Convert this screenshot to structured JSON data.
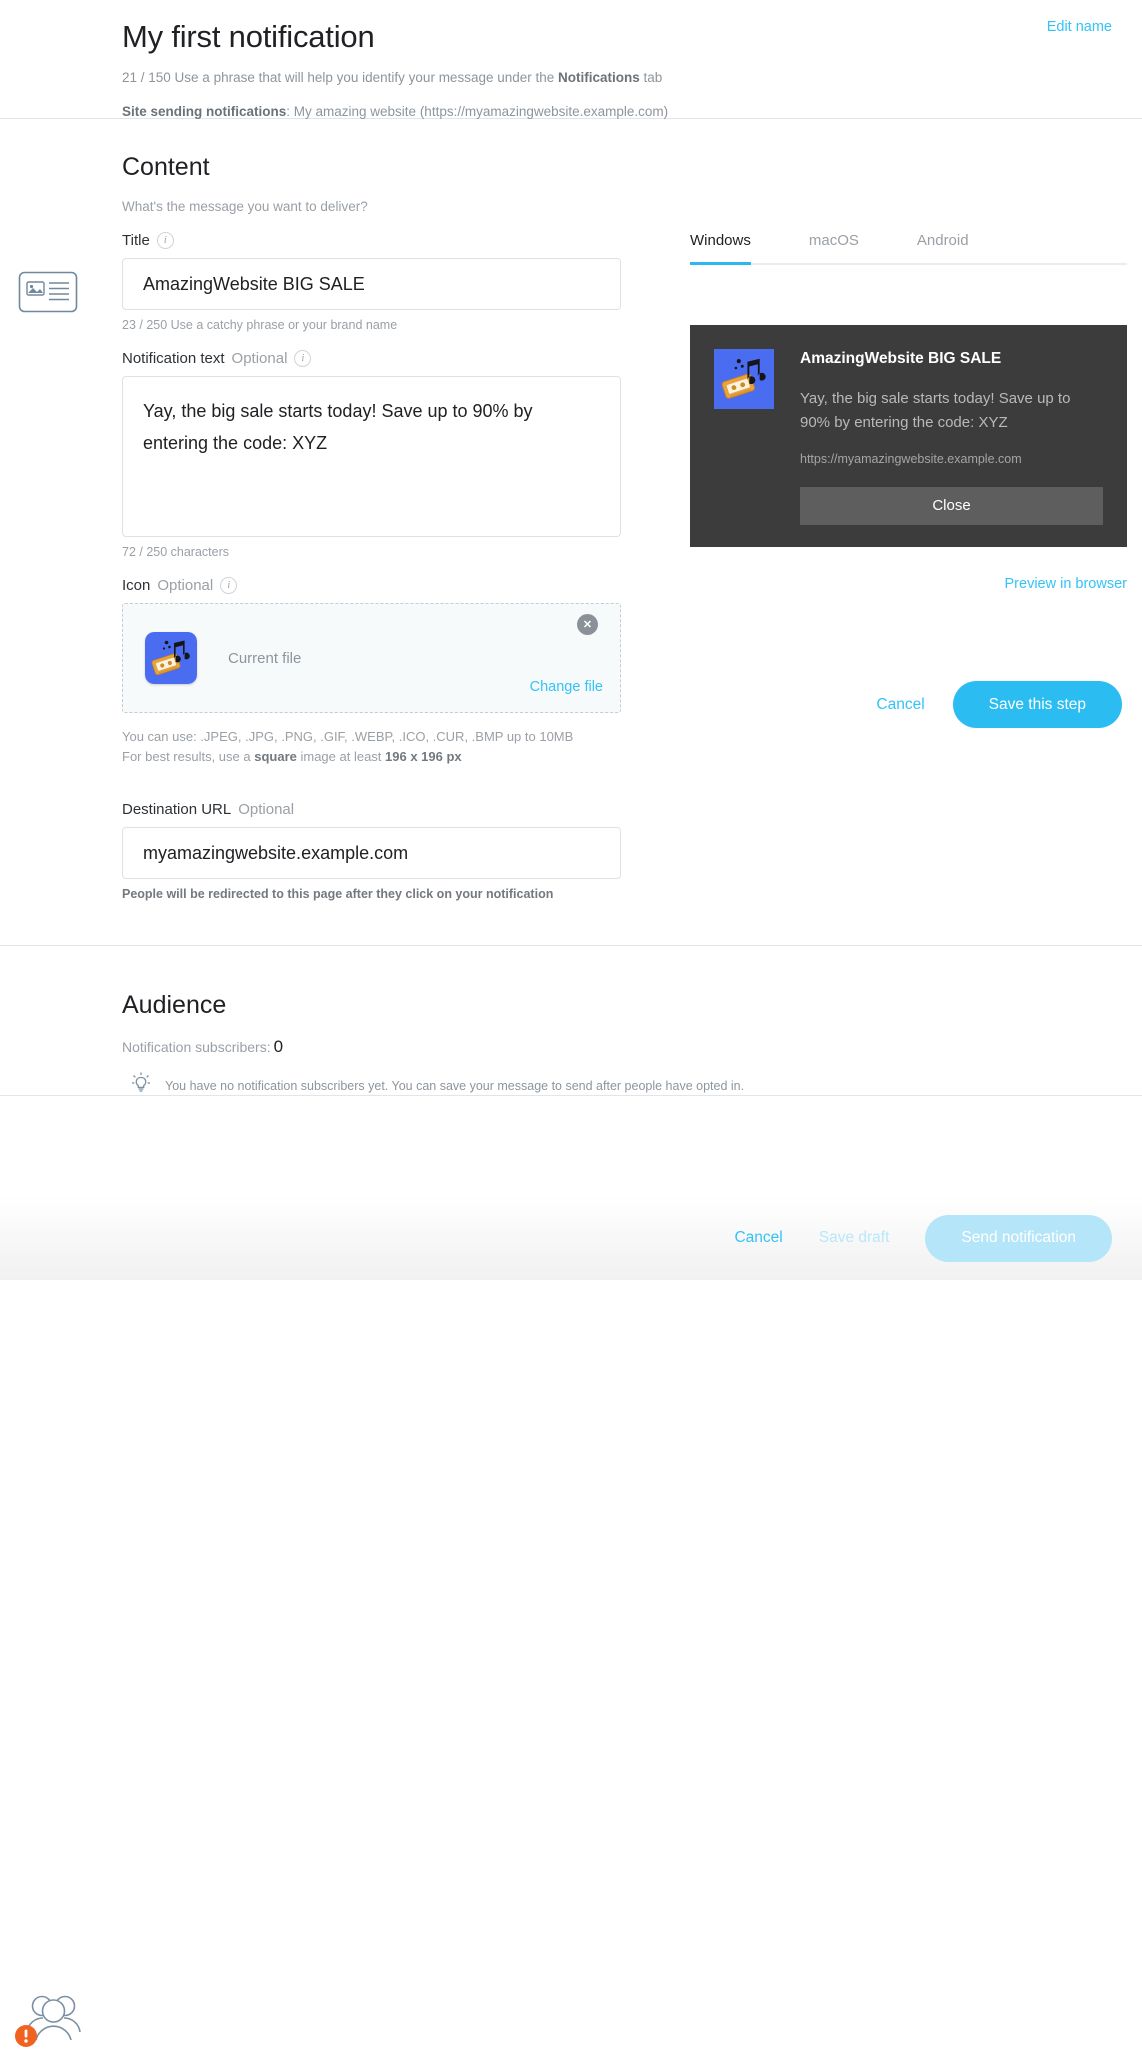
{
  "header": {
    "title": "My first notification",
    "edit_name_label": "Edit name",
    "name_counter": "21 / 150",
    "name_hint_pre": " Use a phrase that will help you identify your message under the ",
    "name_hint_bold": "Notifications",
    "name_hint_post": " tab",
    "site_label": "Site sending notifications",
    "site_value": ": My amazing website (https://myamazingwebsite.example.com)"
  },
  "content": {
    "section_title": "Content",
    "section_desc": "What's the message you want to deliver?",
    "title_field": {
      "label": "Title",
      "info": "i",
      "value": "AmazingWebsite BIG SALE",
      "helper": "23 / 250 Use a catchy phrase or your brand name"
    },
    "text_field": {
      "label": "Notification text",
      "optional": "Optional",
      "info": "i",
      "value": "Yay, the big sale starts today! Save up to 90% by entering the code: XYZ",
      "helper": "72 / 250 characters"
    },
    "icon_field": {
      "label": "Icon",
      "optional": "Optional",
      "info": "i",
      "current_file_label": "Current file",
      "change_file_label": "Change file",
      "remove_label": "✕",
      "note_formats": "You can use: .JPEG, .JPG, .PNG, .GIF, .WEBP, .ICO, .CUR, .BMP up to 10MB",
      "note_best_pre": "For best results, use a ",
      "note_best_bold1": "square",
      "note_best_mid": " image at least ",
      "note_best_bold2": "196 x 196 px"
    },
    "url_field": {
      "label": "Destination URL",
      "optional": "Optional",
      "value": "myamazingwebsite.example.com",
      "helper": "People will be redirected to this page after they click on your notification"
    },
    "tabs": [
      {
        "label": "Windows",
        "active": true
      },
      {
        "label": "macOS",
        "active": false
      },
      {
        "label": "Android",
        "active": false
      }
    ],
    "preview": {
      "title": "AmazingWebsite BIG SALE",
      "body": "Yay, the big sale starts today! Save up to 90% by entering the code: XYZ",
      "url": "https://myamazingwebsite.example.com",
      "close_label": "Close",
      "preview_link_label": "Preview in browser"
    },
    "actions": {
      "cancel_label": "Cancel",
      "save_label": "Save this step"
    }
  },
  "audience": {
    "title": "Audience",
    "subscribers_label": "Notification subscribers:",
    "subscribers_count": "0",
    "tip": "You have no notification subscribers yet. You can save your message to send after people have opted in."
  },
  "footer": {
    "cancel_label": "Cancel",
    "save_draft_label": "Save draft",
    "send_label": "Send notification"
  },
  "colors": {
    "accent": "#2bbdf2",
    "link": "#33c3f7",
    "warning": "#f0621f",
    "preview_bg": "#3c3c3c",
    "icon_bg": "#4a6cf0"
  }
}
